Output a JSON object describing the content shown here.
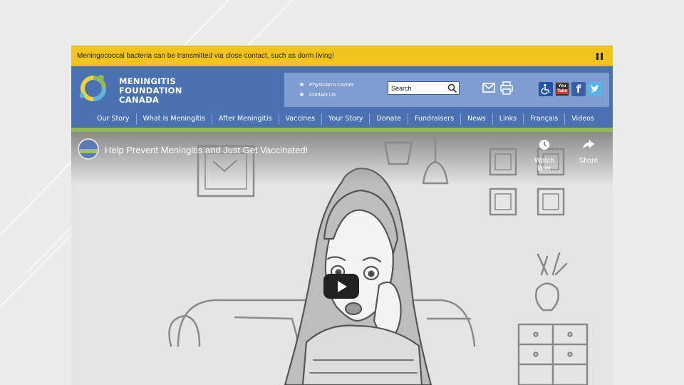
{
  "alert": {
    "text": "Meningococcal bacteria can be transmitted via close contact, such as dorm living!"
  },
  "header": {
    "logo_lines": [
      "MENINGITIS",
      "FOUNDATION",
      "CANADA"
    ],
    "quick_links": [
      "Physician's Corner",
      "Contact Us"
    ],
    "search_value": "Search"
  },
  "nav": {
    "items": [
      "Our Story",
      "What Is Meningitis",
      "After Meningitis",
      "Vaccines",
      "Your Story",
      "Donate",
      "Fundraisers",
      "News",
      "Links",
      "Français",
      "Videos"
    ]
  },
  "video": {
    "title": "Help Prevent Meningitis and Just Get Vaccinated!",
    "watch_later_label": "Watch later",
    "share_label": "Share",
    "icons": [
      "clock-icon",
      "share-icon",
      "play-icon"
    ]
  },
  "social": {
    "youtube_top": "You",
    "youtube_bottom": "Tube"
  },
  "colors": {
    "alert": "#f2c51c",
    "header": "#4a72b3",
    "panel": "#7f9dd1",
    "accent_green": "#8dbb57"
  }
}
